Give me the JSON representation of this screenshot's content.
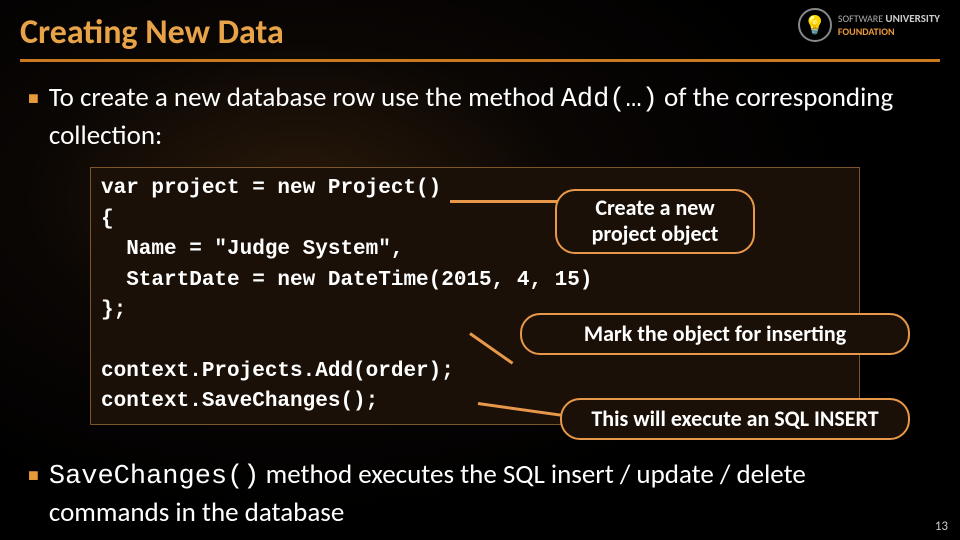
{
  "title": "Creating New Data",
  "logo": {
    "top": "SOFTWARE",
    "uni": "UNIVERSITY",
    "fdn": "FOUNDATION"
  },
  "bullet1_prefix": "To create a new database row use the method ",
  "bullet1_mono": "Add(…)",
  "bullet1_suffix": " of the corresponding collection:",
  "code": "var project = new Project()\n{\n  Name = \"Judge System\",\n  StartDate = new DateTime(2015, 4, 15)\n};\n\ncontext.Projects.Add(order);\ncontext.SaveChanges();",
  "callout1": "Create a new project object",
  "callout2": "Mark the object for inserting",
  "callout3": "This will execute an SQL INSERT",
  "bullet2_mono": "SaveChanges()",
  "bullet2_suffix": " method executes the SQL insert / update / delete commands in the database",
  "page_number": "13"
}
